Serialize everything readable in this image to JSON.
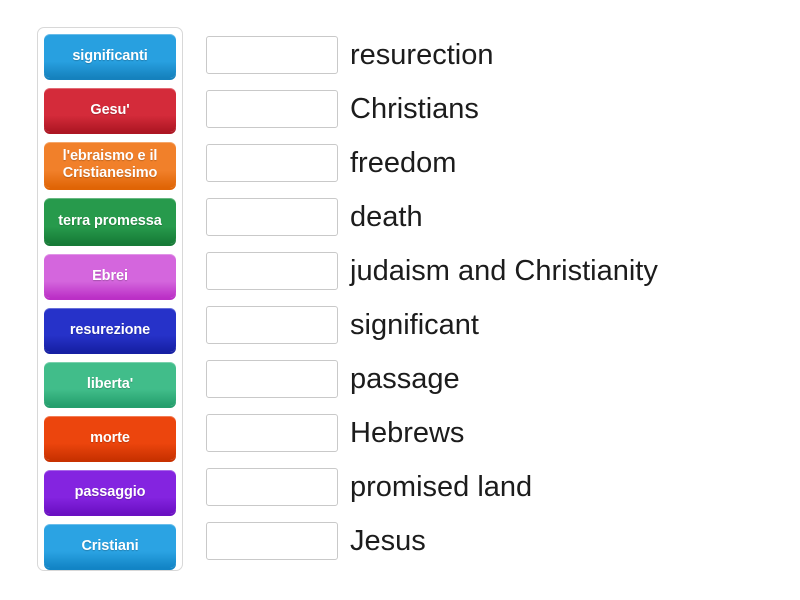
{
  "tray": {
    "label": "word-tile-tray",
    "tiles": [
      {
        "text": "significanti",
        "color": "#28a0e0",
        "color_dark": "#1581bd",
        "lines": 1
      },
      {
        "text": "Gesu'",
        "color": "#d42b3a",
        "color_dark": "#ad1623",
        "lines": 1
      },
      {
        "text": "l'ebraismo e il Cristianesimo",
        "color": "#f1802a",
        "color_dark": "#e06405",
        "lines": 2
      },
      {
        "text": "terra promessa",
        "color": "#279a4c",
        "color_dark": "#167a36",
        "lines": 2
      },
      {
        "text": "Ebrei",
        "color": "#d466dd",
        "color_dark": "#bb2fc6",
        "lines": 1
      },
      {
        "text": "resurezione",
        "color": "#2632c9",
        "color_dark": "#161fa3",
        "lines": 1
      },
      {
        "text": "liberta'",
        "color": "#41bd8a",
        "color_dark": "#249e6c",
        "lines": 1
      },
      {
        "text": "morte",
        "color": "#ec450d",
        "color_dark": "#c83100",
        "lines": 1
      },
      {
        "text": "passaggio",
        "color": "#8424e0",
        "color_dark": "#6a0fc2",
        "lines": 1
      },
      {
        "text": "Cristiani",
        "color": "#2ba3e3",
        "color_dark": "#1284c5",
        "lines": 1
      }
    ]
  },
  "answers": {
    "label": "answer-row-list",
    "rows": [
      {
        "slot_value": "",
        "label": "resurection"
      },
      {
        "slot_value": "",
        "label": "Christians"
      },
      {
        "slot_value": "",
        "label": "freedom"
      },
      {
        "slot_value": "",
        "label": "death"
      },
      {
        "slot_value": "",
        "label": "judaism and Christianity"
      },
      {
        "slot_value": "",
        "label": "significant"
      },
      {
        "slot_value": "",
        "label": "passage"
      },
      {
        "slot_value": "",
        "label": "Hebrews"
      },
      {
        "slot_value": "",
        "label": "promised land"
      },
      {
        "slot_value": "",
        "label": "Jesus"
      }
    ]
  },
  "colors": {
    "page_background": "#ffffff",
    "tray_border": "#d8d8d8",
    "slot_border": "#c9c9c9",
    "label_text": "#1c1c1c"
  }
}
